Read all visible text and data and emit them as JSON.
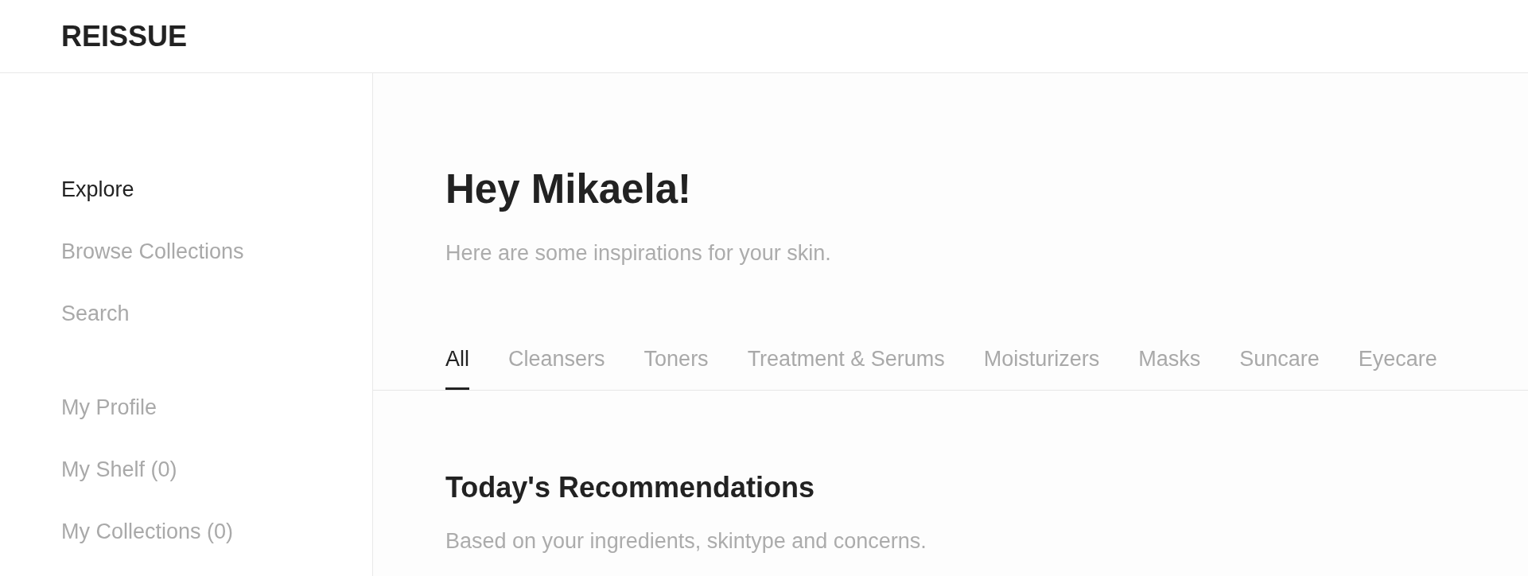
{
  "logo": {
    "text": "REISSUE"
  },
  "sidebar": {
    "groups": [
      {
        "items": [
          {
            "label": "Explore",
            "selected": true
          },
          {
            "label": "Browse Collections",
            "selected": false
          },
          {
            "label": "Search",
            "selected": false
          }
        ]
      },
      {
        "items": [
          {
            "label": "My Profile",
            "selected": false
          },
          {
            "label": "My Shelf (0)",
            "selected": false
          },
          {
            "label": "My Collections (0)",
            "selected": false
          }
        ]
      }
    ]
  },
  "greeting": {
    "title": "Hey Mikaela!",
    "subtitle": "Here are some inspirations for your skin."
  },
  "tabs": [
    {
      "label": "All",
      "selected": true
    },
    {
      "label": "Cleansers",
      "selected": false
    },
    {
      "label": "Toners",
      "selected": false
    },
    {
      "label": "Treatment & Serums",
      "selected": false
    },
    {
      "label": "Moisturizers",
      "selected": false
    },
    {
      "label": "Masks",
      "selected": false
    },
    {
      "label": "Suncare",
      "selected": false
    },
    {
      "label": "Eyecare",
      "selected": false
    }
  ],
  "section": {
    "title": "Today's Recommendations",
    "subtitle": "Based on your ingredients, skintype and concerns."
  }
}
